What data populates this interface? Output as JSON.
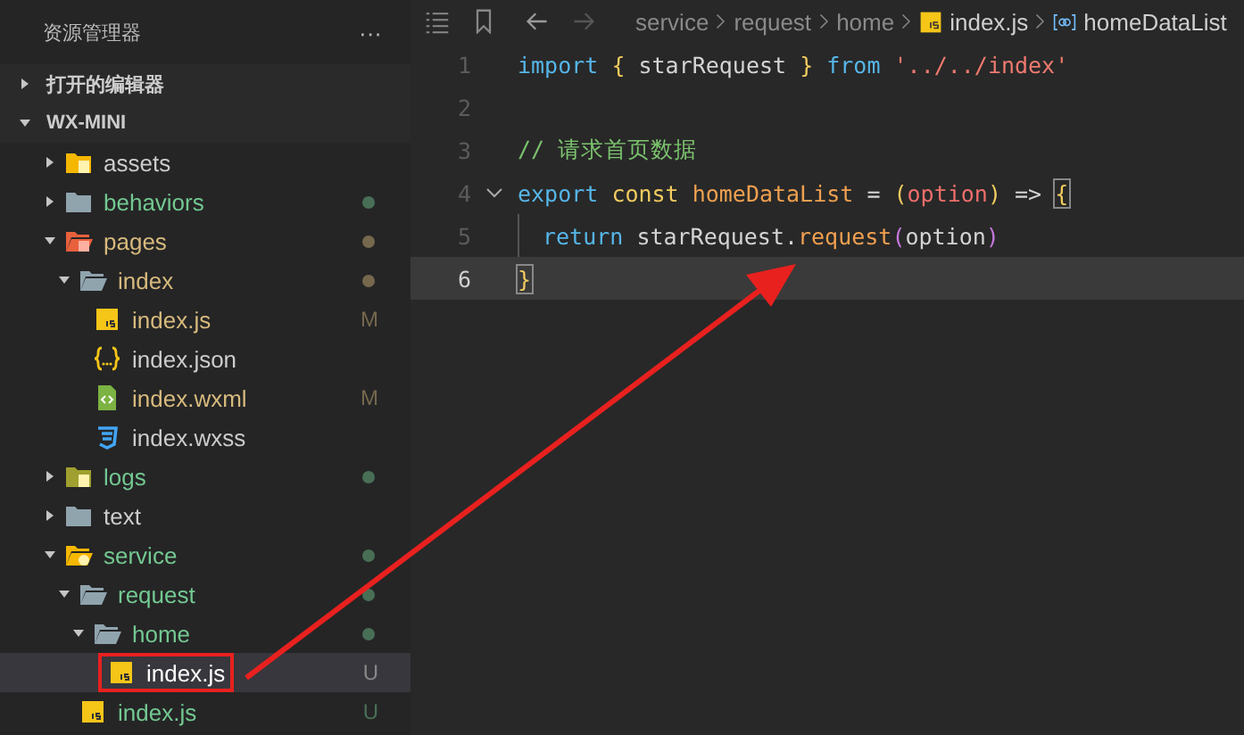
{
  "sidebar": {
    "title": "资源管理器",
    "more": "···",
    "sections": [
      {
        "label": "打开的编辑器",
        "expanded": false
      },
      {
        "label": "WX-MINI",
        "expanded": true
      }
    ],
    "tree": [
      {
        "name": "assets",
        "kind": "folder-assets",
        "expanded": false,
        "color": "#cccccc"
      },
      {
        "name": "behaviors",
        "kind": "folder",
        "expanded": false,
        "color": "#73c991",
        "dot": true
      },
      {
        "name": "pages",
        "kind": "folder-pages",
        "expanded": true,
        "color": "#d7ba7d",
        "dot": true,
        "children": [
          {
            "name": "index",
            "kind": "folder",
            "expanded": true,
            "color": "#d7ba7d",
            "dot": true,
            "children": [
              {
                "name": "index.js",
                "kind": "js",
                "color": "#d7ba7d",
                "badge": "M"
              },
              {
                "name": "index.json",
                "kind": "json",
                "color": "#cccccc"
              },
              {
                "name": "index.wxml",
                "kind": "wxml",
                "color": "#d7ba7d",
                "badge": "M"
              },
              {
                "name": "index.wxss",
                "kind": "wxss",
                "color": "#cccccc"
              }
            ]
          }
        ]
      },
      {
        "name": "logs",
        "kind": "folder-logs",
        "expanded": false,
        "color": "#73c991",
        "dot": true
      },
      {
        "name": "text",
        "kind": "folder",
        "expanded": false,
        "color": "#cccccc"
      },
      {
        "name": "service",
        "kind": "folder-service",
        "expanded": true,
        "color": "#73c991",
        "dot": true,
        "children": [
          {
            "name": "request",
            "kind": "folder",
            "expanded": true,
            "color": "#73c991",
            "dot": true,
            "children": [
              {
                "name": "home",
                "kind": "folder",
                "expanded": true,
                "color": "#73c991",
                "dot": true,
                "children": [
                  {
                    "name": "index.js",
                    "kind": "js",
                    "color": "#ffffff",
                    "badge": "U",
                    "selected": true,
                    "annotated": true
                  }
                ]
              }
            ]
          },
          {
            "name": "index.js",
            "kind": "js",
            "color": "#73c991",
            "badge": "U"
          }
        ]
      }
    ]
  },
  "editor": {
    "nav": {
      "back_enabled": true,
      "forward_enabled": false
    },
    "breadcrumb": [
      {
        "label": "service",
        "kind": "folder"
      },
      {
        "label": "request",
        "kind": "folder"
      },
      {
        "label": "home",
        "kind": "folder"
      },
      {
        "label": "index.js",
        "kind": "file"
      },
      {
        "label": "homeDataList",
        "kind": "symbol"
      }
    ],
    "lines": [
      {
        "number": "1",
        "tokens": [
          {
            "text": "import ",
            "color": "#56b6e8"
          },
          {
            "text": "{ ",
            "color": "#f2cc60"
          },
          {
            "text": "starRequest ",
            "color": "#d4d4d4"
          },
          {
            "text": "} ",
            "color": "#f2cc60"
          },
          {
            "text": "from ",
            "color": "#56b6e8"
          },
          {
            "text": "'../../index'",
            "color": "#ef7a6f"
          }
        ]
      },
      {
        "number": "2"
      },
      {
        "number": "3",
        "tokens": [
          {
            "text": "// 请求首页数据",
            "color": "#7cc36e"
          }
        ]
      },
      {
        "number": "4",
        "fold": true,
        "tokens": [
          {
            "text": "export ",
            "color": "#56b6e8"
          },
          {
            "text": "const ",
            "color": "#f2cc60"
          },
          {
            "text": "homeDataList ",
            "color": "#f0a050"
          },
          {
            "text": "= ",
            "color": "#d4d4d4"
          },
          {
            "text": "(",
            "color": "#f2cc60"
          },
          {
            "text": "option",
            "color": "#ef6f6c"
          },
          {
            "text": ") ",
            "color": "#f2cc60"
          },
          {
            "text": "=> ",
            "color": "#d4d4d4"
          },
          {
            "text": "{",
            "color": "#f2cc60",
            "match": true
          }
        ]
      },
      {
        "number": "5",
        "indent": true,
        "tokens": [
          {
            "text": "return ",
            "color": "#56b6e8"
          },
          {
            "text": "starRequest.",
            "color": "#d4d4d4"
          },
          {
            "text": "request",
            "color": "#f0a050"
          },
          {
            "text": "(",
            "color": "#c678dd"
          },
          {
            "text": "option",
            "color": "#d4d4d4"
          },
          {
            "text": ")",
            "color": "#c678dd"
          }
        ]
      },
      {
        "number": "6",
        "current": true,
        "tokens": [
          {
            "text": "}",
            "color": "#f2cc60",
            "match": true
          }
        ]
      }
    ]
  }
}
